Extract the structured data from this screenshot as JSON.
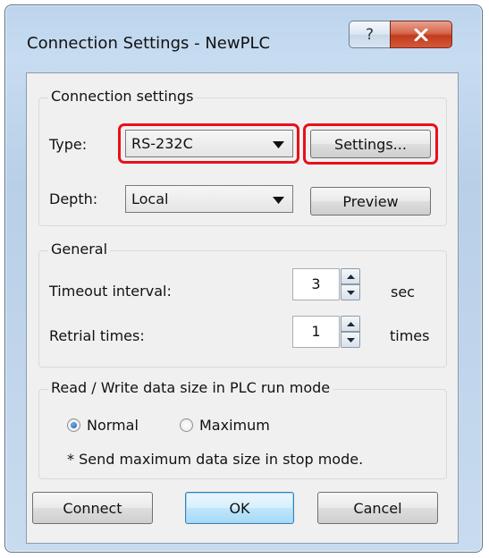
{
  "window": {
    "title": "Connection Settings - NewPLC",
    "help_glyph": "?",
    "close_icon": "close-x-icon"
  },
  "connection": {
    "legend": "Connection settings",
    "type_label": "Type:",
    "type_value": "RS-232C",
    "settings_button": "Settings...",
    "depth_label": "Depth:",
    "depth_value": "Local",
    "preview_button": "Preview"
  },
  "general": {
    "legend": "General",
    "timeout_label": "Timeout interval:",
    "timeout_value": "3",
    "timeout_unit": "sec",
    "retrial_label": "Retrial times:",
    "retrial_value": "1",
    "retrial_unit": "times"
  },
  "readwrite": {
    "legend": "Read / Write data size in PLC run mode",
    "option_normal": "Normal",
    "option_maximum": "Maximum",
    "selected": "Normal",
    "note": "* Send maximum data size in stop mode."
  },
  "footer": {
    "connect_button": "Connect",
    "ok_button": "OK",
    "cancel_button": "Cancel"
  },
  "colors": {
    "highlight": "#e8101a",
    "window_frame": "#bcd4ec",
    "client_bg": "#f0f0f0"
  }
}
